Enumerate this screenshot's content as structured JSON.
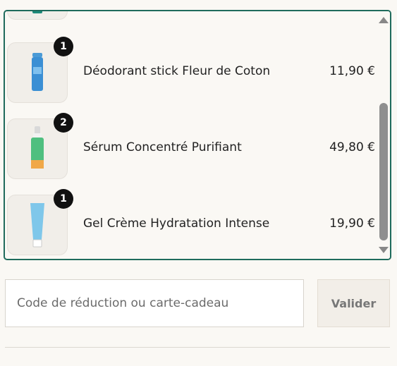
{
  "cart": {
    "items": [
      {
        "name": "",
        "price": "",
        "quantity": "",
        "icon": "product-image-teal-bottle"
      },
      {
        "name": "Déodorant stick Fleur de Coton",
        "price": "11,90 €",
        "quantity": "1",
        "icon": "product-image-deodorant-stick"
      },
      {
        "name": "Sérum Concentré Purifiant",
        "price": "49,80 €",
        "quantity": "2",
        "icon": "product-image-serum-bottle"
      },
      {
        "name": "Gel Crème Hydratation Intense",
        "price": "19,90 €",
        "quantity": "1",
        "icon": "product-image-cream-tube"
      }
    ]
  },
  "discount": {
    "placeholder": "Code de réduction ou carte-cadeau",
    "value": "",
    "apply_label": "Valider"
  },
  "colors": {
    "accent_border": "#1f6b5c",
    "background": "#faf8f4",
    "badge": "#111111",
    "button_bg": "#f2eee8"
  }
}
